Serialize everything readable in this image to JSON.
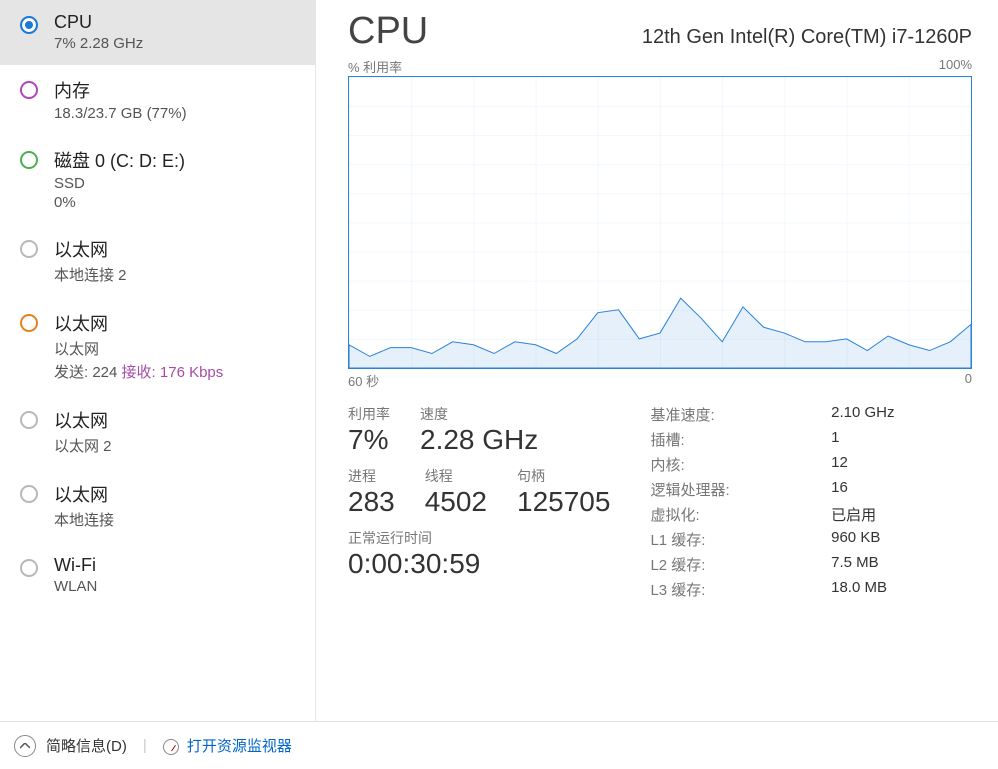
{
  "sidebar": {
    "items": [
      {
        "title": "CPU",
        "sub": "7%  2.28 GHz",
        "ring": "ring-blue solid"
      },
      {
        "title": "内存",
        "sub": "18.3/23.7 GB (77%)",
        "ring": "ring-purple"
      },
      {
        "title": "磁盘 0 (C: D: E:)",
        "sub": "SSD",
        "sub2": "0%",
        "ring": "ring-green"
      },
      {
        "title": "以太网",
        "sub": "本地连接 2",
        "ring": "ring-gray"
      },
      {
        "title": "以太网",
        "sub": "以太网",
        "tx_label": "发送:",
        "tx": "224",
        "rx_label": "接收:",
        "rx": "176 Kbps",
        "ring": "ring-orange"
      },
      {
        "title": "以太网",
        "sub": "以太网 2",
        "ring": "ring-gray"
      },
      {
        "title": "以太网",
        "sub": "本地连接",
        "ring": "ring-gray"
      },
      {
        "title": "Wi-Fi",
        "sub": "WLAN",
        "ring": "ring-gray"
      }
    ]
  },
  "main": {
    "title": "CPU",
    "model": "12th Gen Intel(R) Core(TM) i7-1260P",
    "chart_top_left": "% 利用率",
    "chart_top_right": "100%",
    "chart_bottom_left": "60 秒",
    "chart_bottom_right": "0",
    "big_stats": {
      "util_label": "利用率",
      "util": "7%",
      "speed_label": "速度",
      "speed": "2.28 GHz",
      "proc_label": "进程",
      "proc": "283",
      "thread_label": "线程",
      "thread": "4502",
      "handle_label": "句柄",
      "handle": "125705",
      "uptime_label": "正常运行时间",
      "uptime": "0:00:30:59"
    },
    "specs": [
      {
        "k": "基准速度:",
        "v": "2.10 GHz"
      },
      {
        "k": "插槽:",
        "v": "1"
      },
      {
        "k": "内核:",
        "v": "12"
      },
      {
        "k": "逻辑处理器:",
        "v": "16"
      },
      {
        "k": "虚拟化:",
        "v": "已启用"
      },
      {
        "k": "L1 缓存:",
        "v": "960 KB"
      },
      {
        "k": "L2 缓存:",
        "v": "7.5 MB"
      },
      {
        "k": "L3 缓存:",
        "v": "18.0 MB"
      }
    ]
  },
  "footer": {
    "brief": "简略信息(D)",
    "open_monitor": "打开资源监视器"
  },
  "chart_data": {
    "type": "line",
    "title": "% 利用率",
    "xlabel": "60 秒",
    "ylabel": "% 利用率",
    "ylim": [
      0,
      100
    ],
    "xlim_seconds": [
      60,
      0
    ],
    "x_seconds_ago": [
      60,
      58,
      56,
      54,
      52,
      50,
      48,
      46,
      44,
      42,
      40,
      38,
      36,
      34,
      32,
      30,
      28,
      26,
      24,
      22,
      20,
      18,
      16,
      14,
      12,
      10,
      8,
      6,
      4,
      2,
      0
    ],
    "values_percent": [
      8,
      4,
      7,
      7,
      5,
      9,
      8,
      5,
      9,
      8,
      5,
      10,
      19,
      20,
      10,
      12,
      24,
      17,
      9,
      21,
      14,
      12,
      9,
      9,
      10,
      6,
      11,
      8,
      6,
      9,
      15
    ]
  }
}
